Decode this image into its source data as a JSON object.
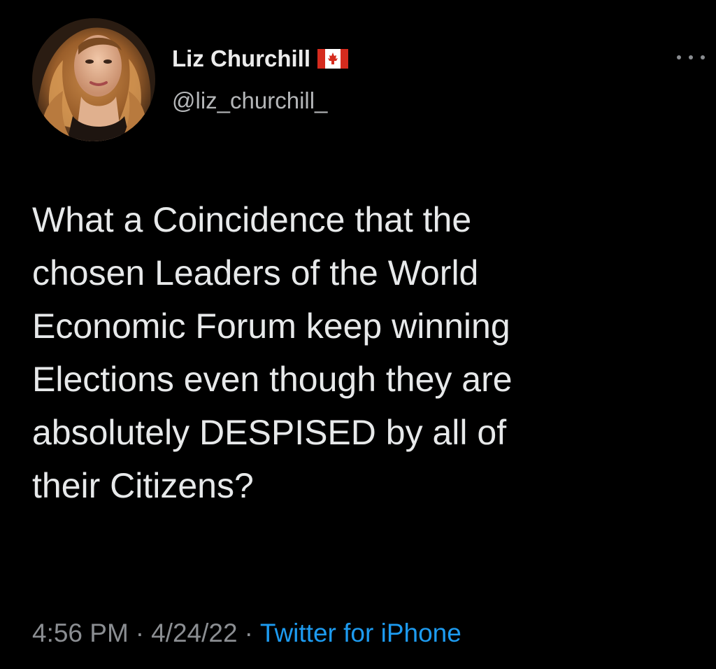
{
  "user": {
    "display_name": "Liz Churchill",
    "handle": "@liz_churchill_",
    "flag_icon": "canada-flag-icon"
  },
  "menu": {
    "icon": "more-options-icon"
  },
  "tweet": {
    "lines": [
      "What a Coincidence that the",
      "chosen Leaders of the World",
      "Economic Forum keep winning",
      "Elections even though they are",
      "absolutely DESPISED by all of",
      "their Citizens?"
    ]
  },
  "meta": {
    "time": "4:56 PM",
    "separator": "·",
    "date": "4/24/22",
    "source": "Twitter for iPhone"
  },
  "colors": {
    "background": "#000000",
    "text": "#e7e9ea",
    "secondary_text": "#8b8e92",
    "link": "#1d9bf0"
  }
}
